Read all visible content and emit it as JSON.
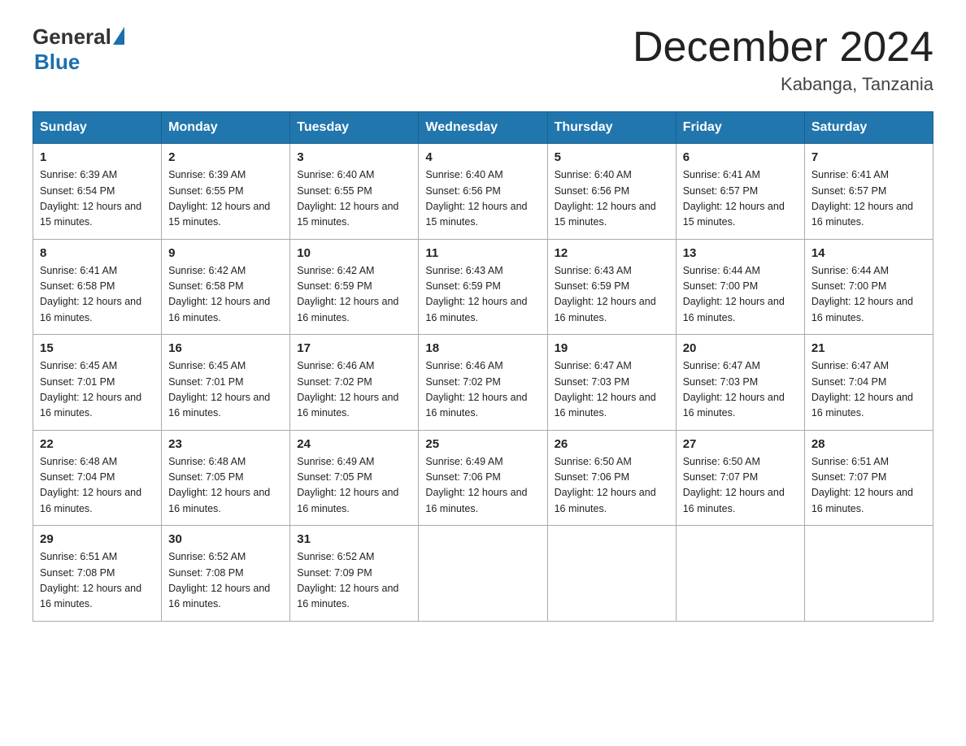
{
  "logo": {
    "general": "General",
    "blue": "Blue"
  },
  "title": "December 2024",
  "location": "Kabanga, Tanzania",
  "days_header": [
    "Sunday",
    "Monday",
    "Tuesday",
    "Wednesday",
    "Thursday",
    "Friday",
    "Saturday"
  ],
  "weeks": [
    [
      {
        "day": "1",
        "sunrise": "6:39 AM",
        "sunset": "6:54 PM",
        "daylight": "12 hours and 15 minutes."
      },
      {
        "day": "2",
        "sunrise": "6:39 AM",
        "sunset": "6:55 PM",
        "daylight": "12 hours and 15 minutes."
      },
      {
        "day": "3",
        "sunrise": "6:40 AM",
        "sunset": "6:55 PM",
        "daylight": "12 hours and 15 minutes."
      },
      {
        "day": "4",
        "sunrise": "6:40 AM",
        "sunset": "6:56 PM",
        "daylight": "12 hours and 15 minutes."
      },
      {
        "day": "5",
        "sunrise": "6:40 AM",
        "sunset": "6:56 PM",
        "daylight": "12 hours and 15 minutes."
      },
      {
        "day": "6",
        "sunrise": "6:41 AM",
        "sunset": "6:57 PM",
        "daylight": "12 hours and 15 minutes."
      },
      {
        "day": "7",
        "sunrise": "6:41 AM",
        "sunset": "6:57 PM",
        "daylight": "12 hours and 16 minutes."
      }
    ],
    [
      {
        "day": "8",
        "sunrise": "6:41 AM",
        "sunset": "6:58 PM",
        "daylight": "12 hours and 16 minutes."
      },
      {
        "day": "9",
        "sunrise": "6:42 AM",
        "sunset": "6:58 PM",
        "daylight": "12 hours and 16 minutes."
      },
      {
        "day": "10",
        "sunrise": "6:42 AM",
        "sunset": "6:59 PM",
        "daylight": "12 hours and 16 minutes."
      },
      {
        "day": "11",
        "sunrise": "6:43 AM",
        "sunset": "6:59 PM",
        "daylight": "12 hours and 16 minutes."
      },
      {
        "day": "12",
        "sunrise": "6:43 AM",
        "sunset": "6:59 PM",
        "daylight": "12 hours and 16 minutes."
      },
      {
        "day": "13",
        "sunrise": "6:44 AM",
        "sunset": "7:00 PM",
        "daylight": "12 hours and 16 minutes."
      },
      {
        "day": "14",
        "sunrise": "6:44 AM",
        "sunset": "7:00 PM",
        "daylight": "12 hours and 16 minutes."
      }
    ],
    [
      {
        "day": "15",
        "sunrise": "6:45 AM",
        "sunset": "7:01 PM",
        "daylight": "12 hours and 16 minutes."
      },
      {
        "day": "16",
        "sunrise": "6:45 AM",
        "sunset": "7:01 PM",
        "daylight": "12 hours and 16 minutes."
      },
      {
        "day": "17",
        "sunrise": "6:46 AM",
        "sunset": "7:02 PM",
        "daylight": "12 hours and 16 minutes."
      },
      {
        "day": "18",
        "sunrise": "6:46 AM",
        "sunset": "7:02 PM",
        "daylight": "12 hours and 16 minutes."
      },
      {
        "day": "19",
        "sunrise": "6:47 AM",
        "sunset": "7:03 PM",
        "daylight": "12 hours and 16 minutes."
      },
      {
        "day": "20",
        "sunrise": "6:47 AM",
        "sunset": "7:03 PM",
        "daylight": "12 hours and 16 minutes."
      },
      {
        "day": "21",
        "sunrise": "6:47 AM",
        "sunset": "7:04 PM",
        "daylight": "12 hours and 16 minutes."
      }
    ],
    [
      {
        "day": "22",
        "sunrise": "6:48 AM",
        "sunset": "7:04 PM",
        "daylight": "12 hours and 16 minutes."
      },
      {
        "day": "23",
        "sunrise": "6:48 AM",
        "sunset": "7:05 PM",
        "daylight": "12 hours and 16 minutes."
      },
      {
        "day": "24",
        "sunrise": "6:49 AM",
        "sunset": "7:05 PM",
        "daylight": "12 hours and 16 minutes."
      },
      {
        "day": "25",
        "sunrise": "6:49 AM",
        "sunset": "7:06 PM",
        "daylight": "12 hours and 16 minutes."
      },
      {
        "day": "26",
        "sunrise": "6:50 AM",
        "sunset": "7:06 PM",
        "daylight": "12 hours and 16 minutes."
      },
      {
        "day": "27",
        "sunrise": "6:50 AM",
        "sunset": "7:07 PM",
        "daylight": "12 hours and 16 minutes."
      },
      {
        "day": "28",
        "sunrise": "6:51 AM",
        "sunset": "7:07 PM",
        "daylight": "12 hours and 16 minutes."
      }
    ],
    [
      {
        "day": "29",
        "sunrise": "6:51 AM",
        "sunset": "7:08 PM",
        "daylight": "12 hours and 16 minutes."
      },
      {
        "day": "30",
        "sunrise": "6:52 AM",
        "sunset": "7:08 PM",
        "daylight": "12 hours and 16 minutes."
      },
      {
        "day": "31",
        "sunrise": "6:52 AM",
        "sunset": "7:09 PM",
        "daylight": "12 hours and 16 minutes."
      },
      null,
      null,
      null,
      null
    ]
  ]
}
